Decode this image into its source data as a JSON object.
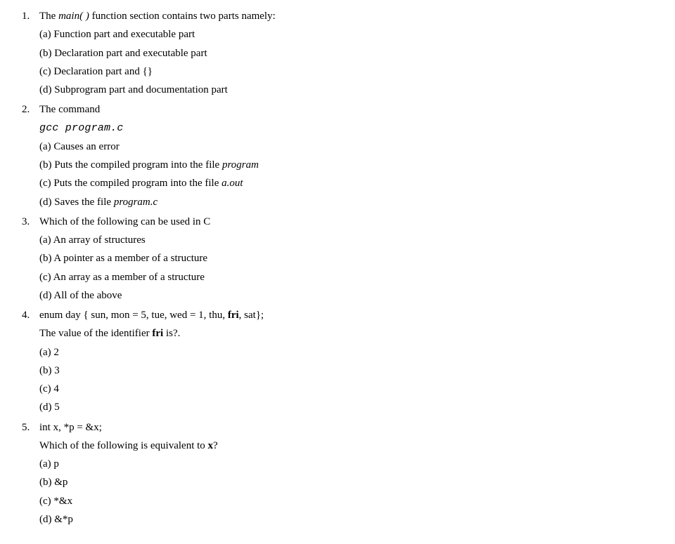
{
  "q1": {
    "stem_pre": "The ",
    "stem_main": "main( )",
    "stem_post": " function section contains two parts namely:",
    "a": "(a) Function part and executable part",
    "b": "(b) Declaration part and executable part",
    "c": "(c) Declaration part and {}",
    "d": "(d) Subprogram part and documentation part"
  },
  "q2": {
    "stem": "The command",
    "code": "gcc  program.c",
    "a": "(a) Causes an error",
    "b_pre": "(b) Puts the compiled program into the file ",
    "b_it": "program",
    "c_pre": "(c) Puts the compiled program into the file ",
    "c_it": "a.out",
    "d_pre": "(d) Saves the file ",
    "d_it": "program.c"
  },
  "q3": {
    "stem": "Which of the following can be used in C",
    "a": "(a) An array of structures",
    "b": "(b) A pointer as a member of a structure",
    "c": "(c) An array as a member of a structure",
    "d": "(d)  All of the above"
  },
  "q4": {
    "stem_pre": "enum  day { sun,  mon = 5,  tue,  wed = 1,  thu,  ",
    "stem_bold": "fri",
    "stem_post": ",  sat};",
    "line2_pre": "The value of the identifier ",
    "line2_bold": "fri",
    "line2_post": "  is?.",
    "a": "(a) 2",
    "b": "(b) 3",
    "c": "(c) 4",
    "d": "(d) 5"
  },
  "q5": {
    "stem": "int x, *p = &x;",
    "line2_pre": "Which of the following is equivalent to ",
    "line2_bold": "x",
    "line2_post": "?",
    "a": "(a) p",
    "b": "(b) &p",
    "c": "(c) *&x",
    "d": "(d) &*p"
  }
}
